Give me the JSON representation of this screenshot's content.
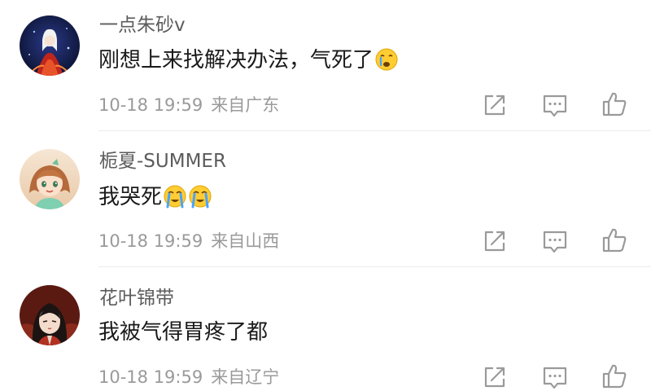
{
  "comments": [
    {
      "username": "一点朱砂v",
      "text": "刚想上来找解决办法，气死了",
      "emojis": [
        "crying-face"
      ],
      "time": "10-18 19:59",
      "location": "来自广东"
    },
    {
      "username": "栀夏-SUMMER",
      "text": "我哭死",
      "emojis": [
        "loudly-crying-face",
        "loudly-crying-face"
      ],
      "time": "10-18 19:59",
      "location": "来自山西"
    },
    {
      "username": "花叶锦带",
      "text": "我被气得胃疼了都",
      "emojis": [],
      "time": "10-18 19:59",
      "location": "来自辽宁"
    }
  ],
  "actions": {
    "icons": [
      "share-icon",
      "reply-icon",
      "like-icon"
    ]
  },
  "colors": {
    "username": "#5c5c5c",
    "text": "#1a1a1a",
    "meta": "#9a9a9a",
    "icon": "#9a9a9a",
    "divider": "#ebebeb"
  }
}
